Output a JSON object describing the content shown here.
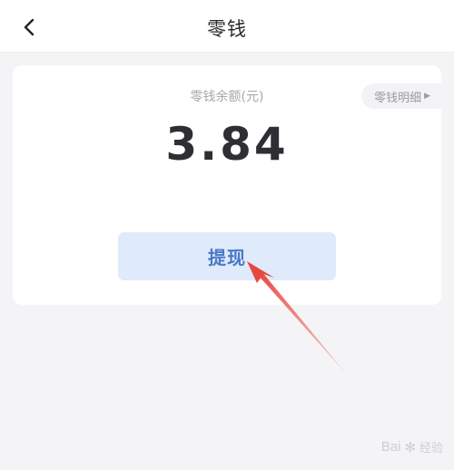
{
  "header": {
    "title": "零钱",
    "back_icon": "chevron-left-icon"
  },
  "balance": {
    "label": "零钱余额(元)",
    "value": "3.84",
    "detail_label": "零钱明细"
  },
  "actions": {
    "withdraw_label": "提现"
  },
  "annotation": {
    "color": "#e8473f"
  },
  "watermark": {
    "brand": "Bai",
    "suffix": "经验"
  }
}
